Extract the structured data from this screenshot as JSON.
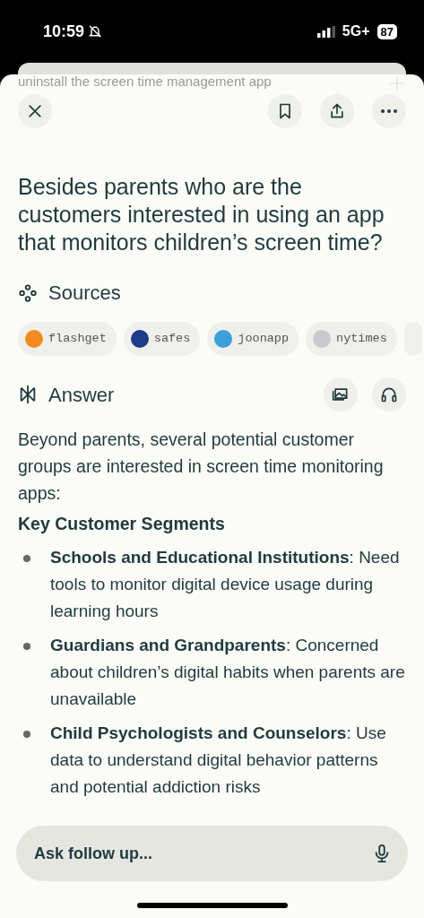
{
  "status_bar": {
    "time": "10:59",
    "network": "5G+",
    "battery": "87"
  },
  "previous_query": "uninstall the screen time management app",
  "question": "Besides parents who are the customers interested in using an app that monitors children’s screen time?",
  "sources": {
    "title": "Sources",
    "items": [
      {
        "label": "flashget",
        "color": "#f58a1f"
      },
      {
        "label": "safes",
        "color": "#1e3a8a"
      },
      {
        "label": "joonapp",
        "color": "#3b9fd8"
      },
      {
        "label": "nytimes",
        "color": "#c9c9cf"
      }
    ]
  },
  "answer": {
    "title": "Answer",
    "intro": "Beyond parents, several potential customer groups are interested in screen time monitoring apps:",
    "heading": "Key Customer Segments",
    "bullets": [
      {
        "term": "Schools and Educational Institutions",
        "text": ": Need tools to monitor digital device usage during learning hours"
      },
      {
        "term": "Guardians and Grandparents",
        "text": ": Concerned about children’s digital habits when parents are unavailable"
      },
      {
        "term": "Child Psychologists and Counselors",
        "text": ": Use data to understand digital behavior patterns and potential addiction risks"
      }
    ]
  },
  "follow_up": {
    "placeholder": "Ask follow up..."
  }
}
